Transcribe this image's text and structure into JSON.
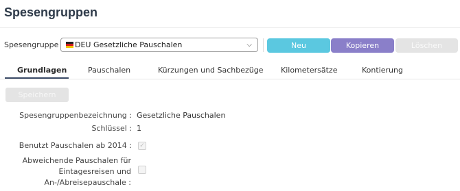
{
  "page": {
    "title": "Spesengruppen"
  },
  "toolbar": {
    "group_label": "Spesengruppe :",
    "select_value": "DEU  Gesetzliche Pauschalen",
    "buttons": {
      "new": "Neu",
      "copy": "Kopieren",
      "delete": "Löschen"
    }
  },
  "tabs": [
    {
      "label": "Grundlagen",
      "active": true
    },
    {
      "label": "Pauschalen"
    },
    {
      "label": "Kürzungen und Sachbezüge"
    },
    {
      "label": "Kilometersätze"
    },
    {
      "label": "Kontierung"
    }
  ],
  "form": {
    "save_label": "Speichern",
    "fields": {
      "name_label": "Spesengruppenbezeichnung :",
      "name_value": "Gesetzliche Pauschalen",
      "key_label": "Schlüssel :",
      "key_value": "1",
      "flat_since_label": "Benutzt Pauschalen ab 2014 :",
      "flat_since_checked": true,
      "deviating_label_1": "Abweichende Pauschalen für",
      "deviating_label_2": "Eintagesreisen und",
      "deviating_label_3": "An-/Abreisepauschale :",
      "deviating_checked": false
    }
  },
  "colors": {
    "new_button": "#5bc8e0",
    "copy_button": "#8a7fc9",
    "disabled_button": "#e4e4e4",
    "tab_underline": "#3a4a66"
  },
  "icons": {
    "flag": "germany-flag-icon",
    "dropdown": "chevron-down-icon",
    "check": "check-icon"
  }
}
